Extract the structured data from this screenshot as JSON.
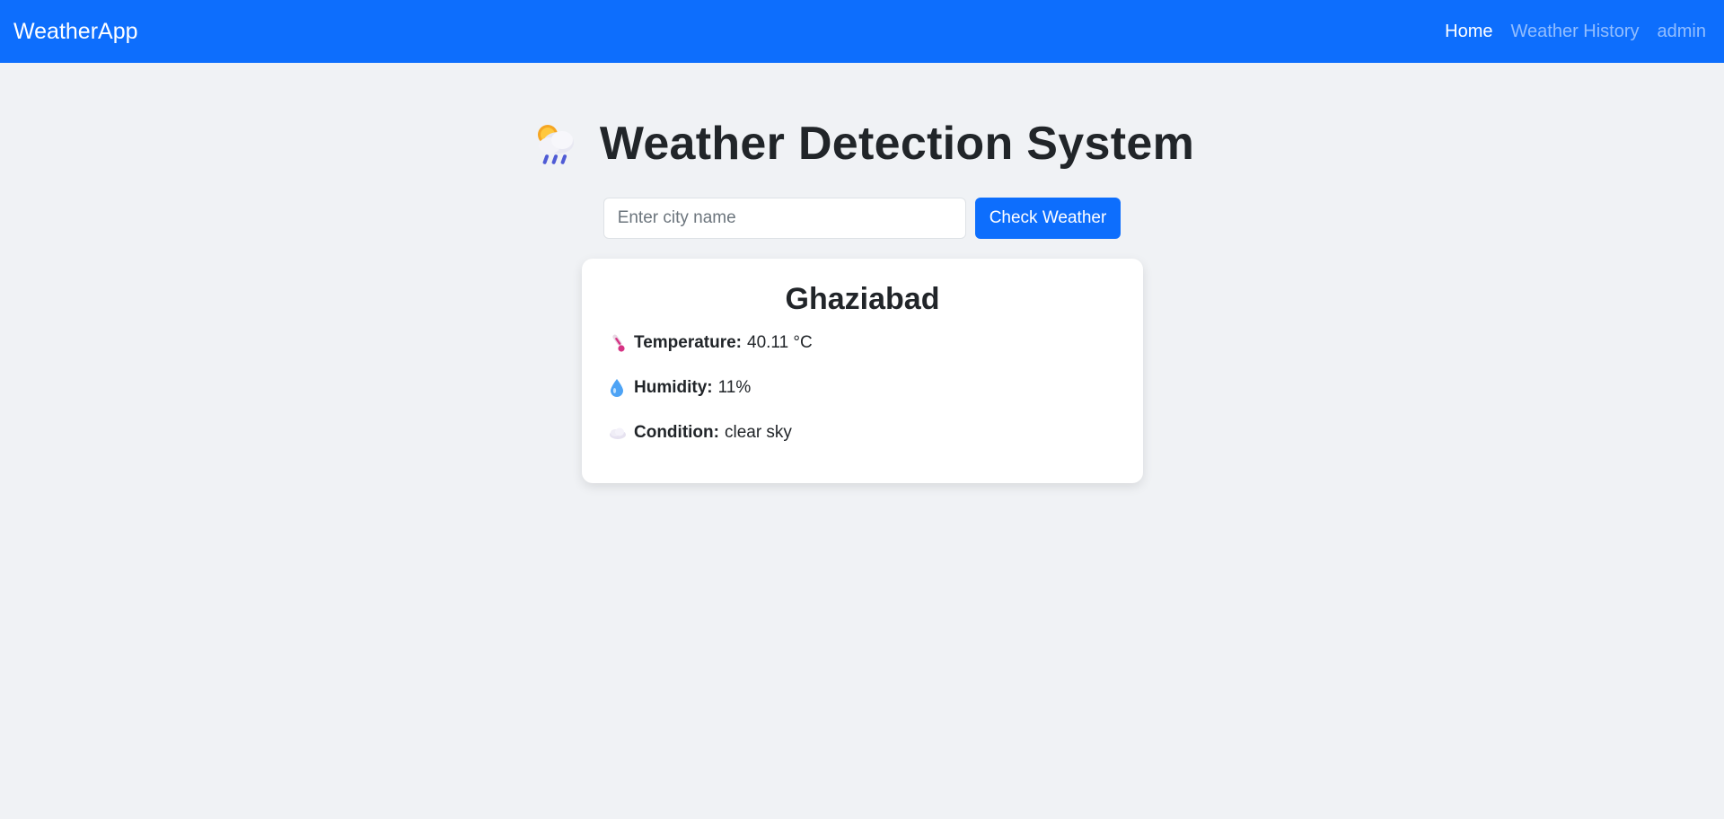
{
  "navbar": {
    "brand": "WeatherApp",
    "links": [
      {
        "label": "Home",
        "active": true
      },
      {
        "label": "Weather History",
        "active": false
      },
      {
        "label": "admin",
        "active": false
      }
    ],
    "bg_color": "#0d6efd"
  },
  "header": {
    "icon": "sun-cloud-rain-icon",
    "title": "Weather Detection System"
  },
  "search": {
    "placeholder": "Enter city name",
    "value": "",
    "button_label": "Check Weather"
  },
  "result": {
    "city": "Ghaziabad",
    "rows": [
      {
        "icon": "thermometer-icon",
        "label": "Temperature:",
        "value": "40.11 °C"
      },
      {
        "icon": "droplet-icon",
        "label": "Humidity:",
        "value": "11%"
      },
      {
        "icon": "cloud-icon",
        "label": "Condition:",
        "value": "clear sky"
      }
    ]
  }
}
